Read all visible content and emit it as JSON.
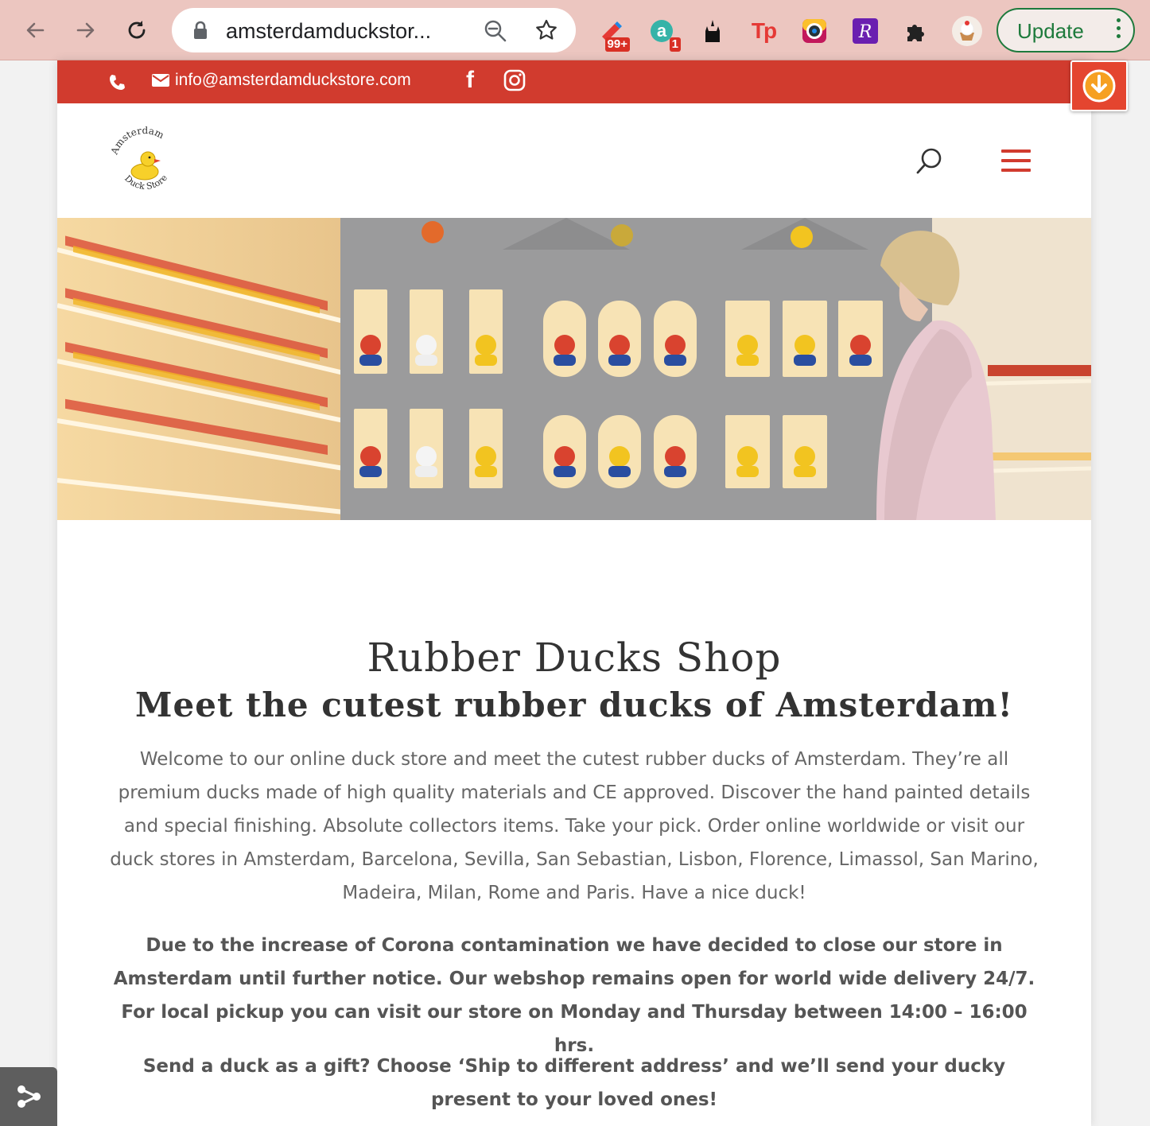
{
  "browser": {
    "url": "amsterdamduckstor...",
    "extensions": [
      {
        "name": "toolbox-extension-icon",
        "badge": "99+"
      },
      {
        "name": "a-extension-icon",
        "badge": "1"
      },
      {
        "name": "castle-extension-icon"
      },
      {
        "name": "tp-extension-icon",
        "label": "Tp"
      },
      {
        "name": "camera-extension-icon"
      },
      {
        "name": "r-extension-icon",
        "label": "R"
      },
      {
        "name": "puzzle-extension-icon"
      },
      {
        "name": "profile-avatar-icon"
      }
    ],
    "update_label": "Update"
  },
  "topbar": {
    "email": "info@amsterdamduckstore.com",
    "facebook": "f",
    "color": "#d13b2e"
  },
  "header": {
    "logo_top": "Amsterdam",
    "logo_bottom": "Duck Store"
  },
  "content": {
    "title": "Rubber Ducks Shop",
    "subtitle": "Meet the cutest rubber ducks of Amsterdam!",
    "intro": "Welcome to our online duck store and meet the cutest rubber ducks of Amsterdam. They’re all premium ducks made of high quality materials and CE approved. Discover the hand painted details and special finishing. Absolute collectors items. Take your pick. Order online worldwide or visit our duck stores in Amsterdam, Barcelona, Sevilla, San Sebastian, Lisbon, Florence, Limassol, San Marino, Madeira, Milan, Rome and Paris. Have a nice duck!",
    "notice": "Due to the increase of Corona contamination we have decided to close our store in Amsterdam until further notice. Our webshop remains open for world wide delivery 24/7. For local pickup you can visit our store on Monday and Thursday between 14:00 – 16:00 hrs.",
    "gift": "Send a duck as a gift? Choose ‘Ship to different address’ and we’ll send your ducky present to your loved ones!"
  }
}
